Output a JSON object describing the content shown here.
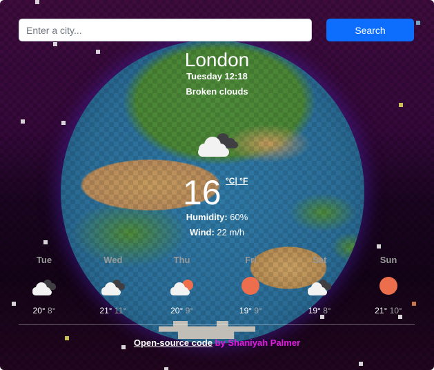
{
  "search": {
    "placeholder": "Enter a city...",
    "value": "",
    "button_label": "Search"
  },
  "current": {
    "city": "London",
    "datetime": "Tuesday 12:18",
    "description": "Broken clouds",
    "icon": "broken-clouds-icon",
    "temperature": "16",
    "unit_celsius": "°C",
    "unit_separator": "|",
    "unit_fahrenheit": " °F",
    "humidity_label": "Humidity:",
    "humidity_value": " 60%",
    "wind_label": "Wind:",
    "wind_value": " 22 m/h"
  },
  "forecast": [
    {
      "day": "Tue",
      "icon": "broken-clouds-icon",
      "max": "20°",
      "min": " 8°"
    },
    {
      "day": "Wed",
      "icon": "broken-clouds-icon",
      "max": "21°",
      "min": " 11°"
    },
    {
      "day": "Thu",
      "icon": "few-clouds-icon",
      "max": "20°",
      "min": " 9°"
    },
    {
      "day": "Fri",
      "icon": "clear-sky-icon",
      "max": "19°",
      "min": " 9°"
    },
    {
      "day": "Sat",
      "icon": "broken-clouds-icon",
      "max": "19°",
      "min": " 8°"
    },
    {
      "day": "Sun",
      "icon": "clear-sky-icon",
      "max": "21°",
      "min": " 10°"
    }
  ],
  "footer": {
    "link_text": "Open-source code",
    "author_text": " by Shaniyah Palmer"
  },
  "colors": {
    "accent": "#0d6efd",
    "sun": "#ec6e4c",
    "author": "#e11be0"
  }
}
